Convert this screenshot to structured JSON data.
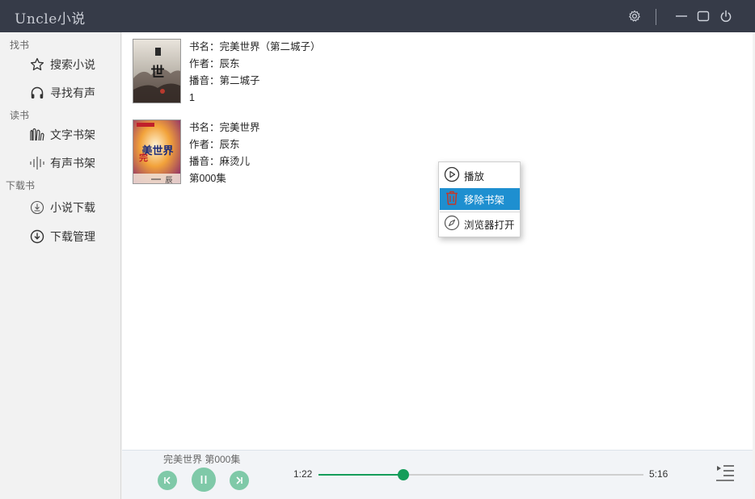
{
  "app": {
    "title": "Uncle小说"
  },
  "titlebar": {
    "icons": [
      "gear-icon",
      "minimize-icon",
      "maximize-icon",
      "power-icon"
    ]
  },
  "sidebar": {
    "sections": [
      {
        "title": "找书",
        "items": [
          {
            "label": "搜索小说",
            "icon": "star-icon"
          },
          {
            "label": "寻找有声",
            "icon": "headphones-icon"
          }
        ]
      },
      {
        "title": "读书",
        "items": [
          {
            "label": "文字书架",
            "icon": "books-icon"
          },
          {
            "label": "有声书架",
            "icon": "soundwave-icon"
          }
        ]
      },
      {
        "title": "下载书",
        "items": [
          {
            "label": "小说下载",
            "icon": "download-circle-icon"
          },
          {
            "label": "下载管理",
            "icon": "download-cloud-icon"
          }
        ]
      }
    ]
  },
  "books": [
    {
      "title_line": "书名：完美世界（第二城子）",
      "author_line": "作者：辰东",
      "narrator_line": "播音：第二城子",
      "progress": "1"
    },
    {
      "title_line": "书名：完美世界",
      "author_line": "作者：辰东",
      "narrator_line": "播音：麻烫儿",
      "progress": "第000集"
    }
  ],
  "context_menu": {
    "items": [
      {
        "label": "播放",
        "icon": "play-circle-icon"
      },
      {
        "label": "移除书架",
        "icon": "trash-icon"
      },
      {
        "label": "浏览器打开",
        "icon": "compass-icon"
      }
    ],
    "active_index": 1
  },
  "player": {
    "now_playing": "完美世界 第000集",
    "current_time": "1:22",
    "total_time": "5:16",
    "progress_fraction": 0.26,
    "accent": "#159d5a",
    "button_color": "#7fc9a8"
  },
  "colors": {
    "titlebar": "#363b48",
    "menu_active": "#1e8fd0",
    "trash_red": "#c0392b"
  }
}
